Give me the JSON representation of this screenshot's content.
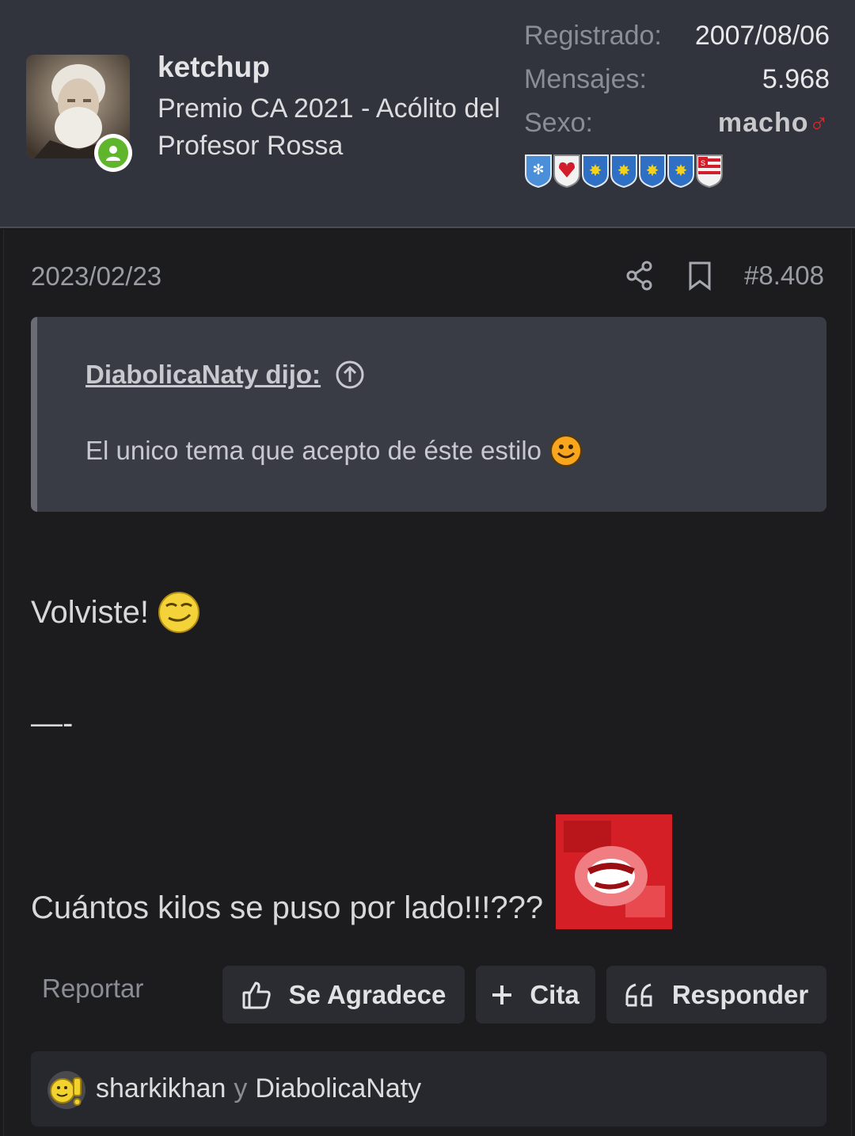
{
  "user": {
    "username": "ketchup",
    "title": "Premio CA 2021 - Acólito del Profesor Rossa",
    "online": true
  },
  "stats": {
    "registered_label": "Registrado:",
    "registered_value": "2007/08/06",
    "messages_label": "Mensajes:",
    "messages_value": "5.968",
    "sex_label": "Sexo:",
    "sex_value": "macho",
    "sex_symbol": "♂"
  },
  "badges": [
    "snowflake-shield",
    "heart-shield",
    "star-shield",
    "star-shield",
    "star-shield",
    "star-shield",
    "flag-shield"
  ],
  "post": {
    "date": "2023/02/23",
    "number": "#8.408",
    "quote": {
      "author": "DiabolicaNaty dijo:",
      "text": "El unico tema que acepto de éste estilo"
    },
    "lines": {
      "line1": "Volviste!",
      "line2": "—-",
      "line3": "Cuántos kilos se puso por lado!!!???"
    },
    "actions": {
      "report": "Reportar",
      "thanks": "Se Agradece",
      "quote": "Cita",
      "reply": "Responder"
    },
    "likes": {
      "user1": "sharkikhan",
      "connector": "y",
      "user2": "DiabolicaNaty"
    }
  },
  "colors": {
    "header_bg": "#32343d",
    "post_bg": "#1c1c1e",
    "quote_bg": "#393b45",
    "online_green": "#5fb52c"
  }
}
